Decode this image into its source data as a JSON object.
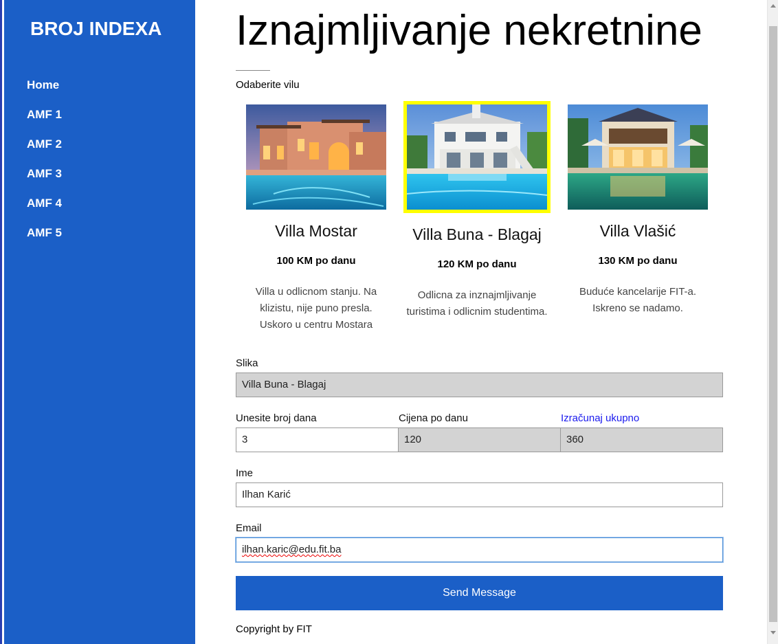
{
  "sidebar": {
    "brand": "BROJ INDEXA",
    "nav": [
      {
        "label": "Home"
      },
      {
        "label": "AMF 1"
      },
      {
        "label": "AMF 2"
      },
      {
        "label": "AMF 3"
      },
      {
        "label": "AMF 4"
      },
      {
        "label": "AMF 5"
      }
    ],
    "background_color": "#1b5fc7"
  },
  "main": {
    "title": "Iznajmljivanje nekretnine",
    "choose_label": "Odaberite vilu",
    "villas": [
      {
        "name": "Villa Mostar",
        "price": "100 KM po danu",
        "description": "Villa u odlicnom stanju. Na klizistu, nije puno presla. Uskoro u centru Mostara",
        "selected": false
      },
      {
        "name": "Villa Buna - Blagaj",
        "price": "120 KM po danu",
        "description": "Odlicna za inznajmljivanje turistima i odlicnim studentima.",
        "selected": true
      },
      {
        "name": "Villa Vlašić",
        "price": "130 KM po danu",
        "description": "Buduće kancelarije FIT-a. Iskreno se nadamo.",
        "selected": false
      }
    ],
    "selected_highlight_color": "#ffff00",
    "form": {
      "slika_label": "Slika",
      "slika_value": "Villa Buna - Blagaj",
      "days_label": "Unesite broj dana",
      "days_value": "3",
      "price_label": "Cijena po danu",
      "price_value": "120",
      "calc_link": "Izračunaj ukupno",
      "total_value": "360",
      "name_label": "Ime",
      "name_value": "Ilhan Karić",
      "email_label": "Email",
      "email_value": "ilhan.karic@edu.fit.ba",
      "send_label": "Send Message"
    },
    "copyright": "Copyright by FIT"
  }
}
